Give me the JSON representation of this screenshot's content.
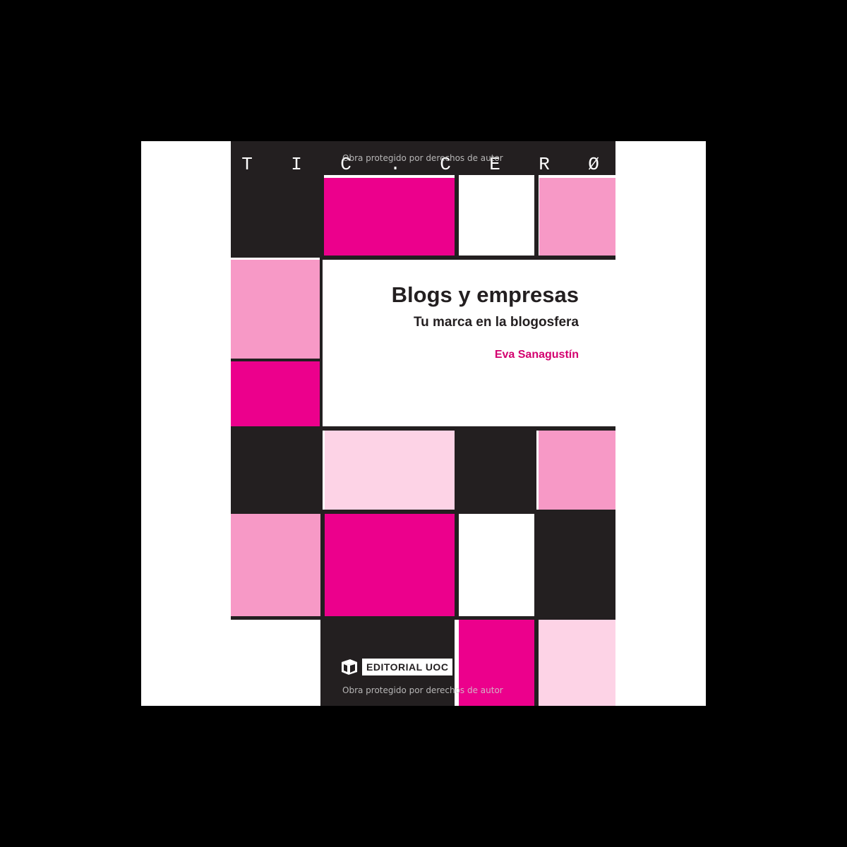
{
  "cover": {
    "series_letters": [
      "T",
      "I",
      "C",
      ".",
      "C",
      "E",
      "R",
      "Ø"
    ],
    "watermark_top": "Obra protegido por derechos de autor",
    "title": "Blogs y empresas",
    "subtitle": "Tu marca en la blogosfera",
    "author": "Eva Sanagustín",
    "publisher": "EDITORIAL UOC",
    "watermark_bottom": "Obra protegido por derechos de autor"
  },
  "colors": {
    "background": "#000000",
    "black_tile": "#231f20",
    "magenta": "#ec008c",
    "pink": "#f799c6",
    "light_pink": "#fdd3e6",
    "author_text": "#d4006f"
  }
}
